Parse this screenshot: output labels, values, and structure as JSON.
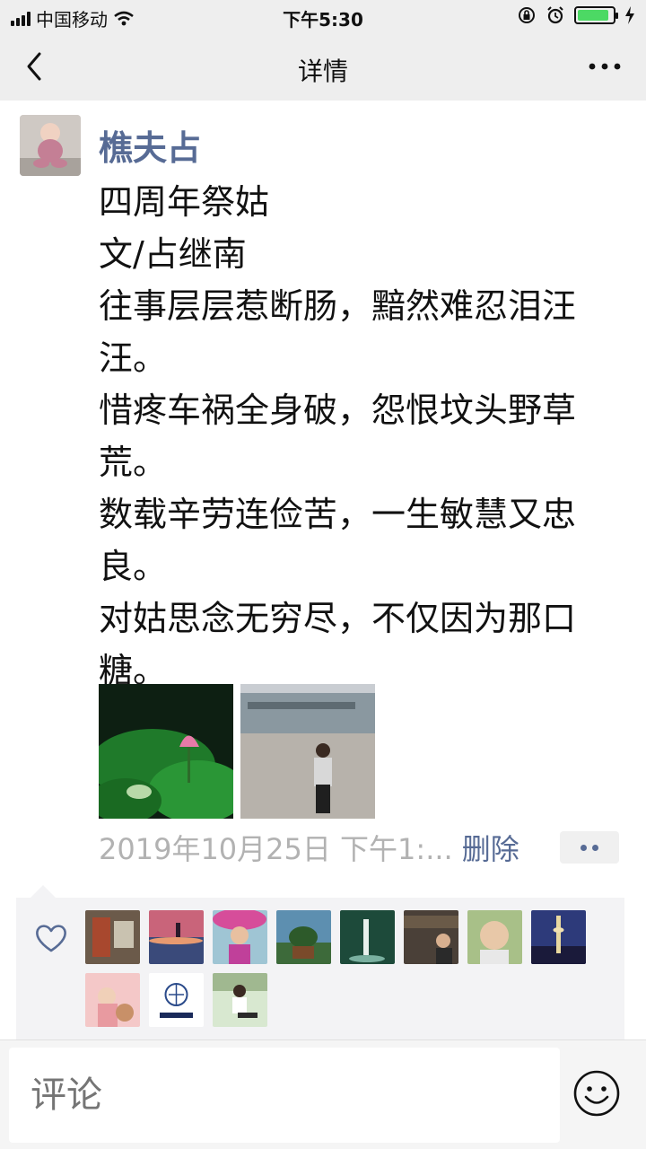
{
  "status_bar": {
    "carrier": "中国移动",
    "time": "下午5:30",
    "battery_level": 0.9
  },
  "nav": {
    "title": "详情",
    "back_icon": "chevron-left-icon",
    "more_icon": "more-icon"
  },
  "post": {
    "author": "樵夫占",
    "content": "四周年祭姑\n文/占继南\n往事层层惹断肠，黯然难忍泪汪汪。\n惜疼车祸全身破，怨恨坟头野草荒。\n数载辛劳连俭苦，一生敏慧又忠良。\n对姑思念无穷尽，不仅因为那口糖。",
    "time": "2019年10月25日 下午1:...",
    "delete_label": "删除"
  },
  "comment": {
    "placeholder": "评论"
  },
  "colors": {
    "link": "#576b95",
    "meta": "#b2b2b2",
    "battery": "#4cd964"
  }
}
